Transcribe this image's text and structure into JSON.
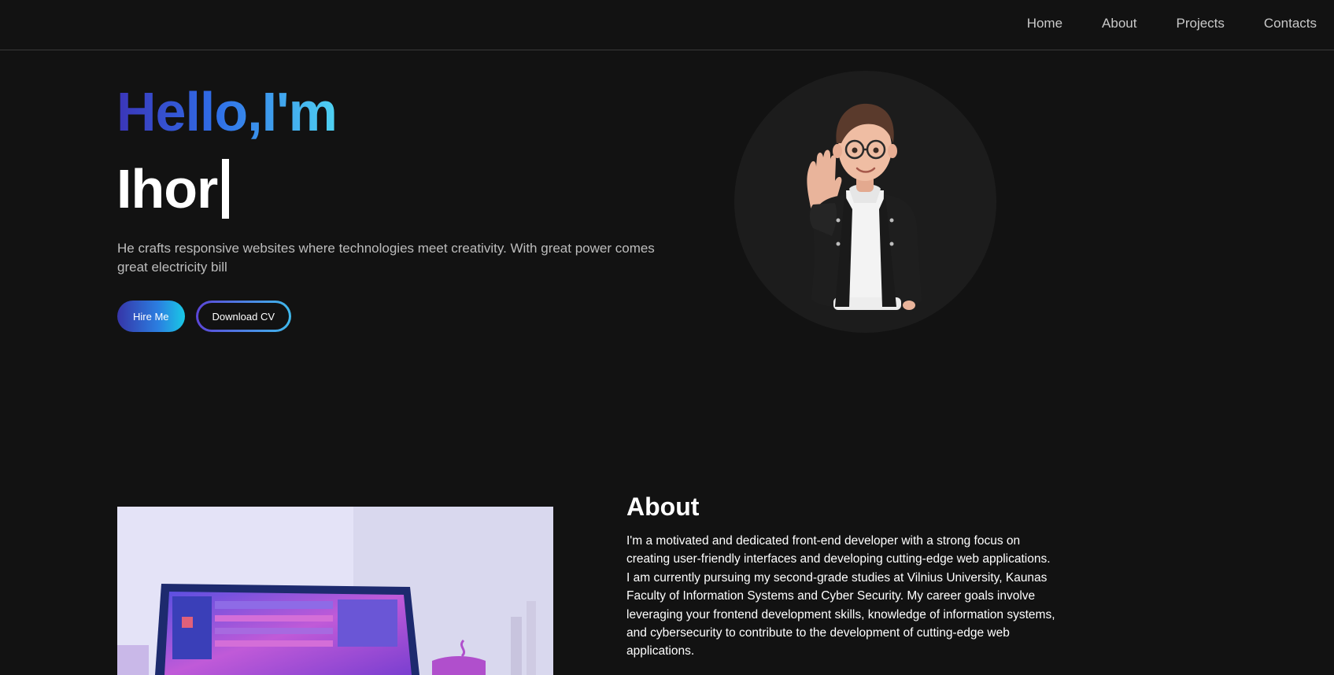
{
  "nav": {
    "items": [
      {
        "label": "Home"
      },
      {
        "label": "About"
      },
      {
        "label": "Projects"
      },
      {
        "label": "Contacts"
      }
    ]
  },
  "hero": {
    "greeting": "Hello,I'm",
    "name": "Ihor",
    "tagline": "He crafts responsive websites where technologies meet creativity. With great power comes great electricity bill",
    "hire_label": "Hire Me",
    "cv_label": "Download CV",
    "avatar": "waving-avatar-illustration"
  },
  "about": {
    "title": "About",
    "text": "I'm a motivated and dedicated front-end developer with a strong focus on creating user-friendly interfaces and developing cutting-edge web applications. I am currently pursuing my second-grade studies at Vilnius University, Kaunas Faculty of Information Systems and Cyber Security. My career goals involve leveraging your frontend development skills, knowledge of information systems, and cybersecurity to contribute to the development of cutting-edge web applications.",
    "image": "laptop-workspace-illustration"
  },
  "colors": {
    "background": "#121212",
    "gradient_start": "#3b35b8",
    "gradient_end": "#4fd3f2"
  }
}
